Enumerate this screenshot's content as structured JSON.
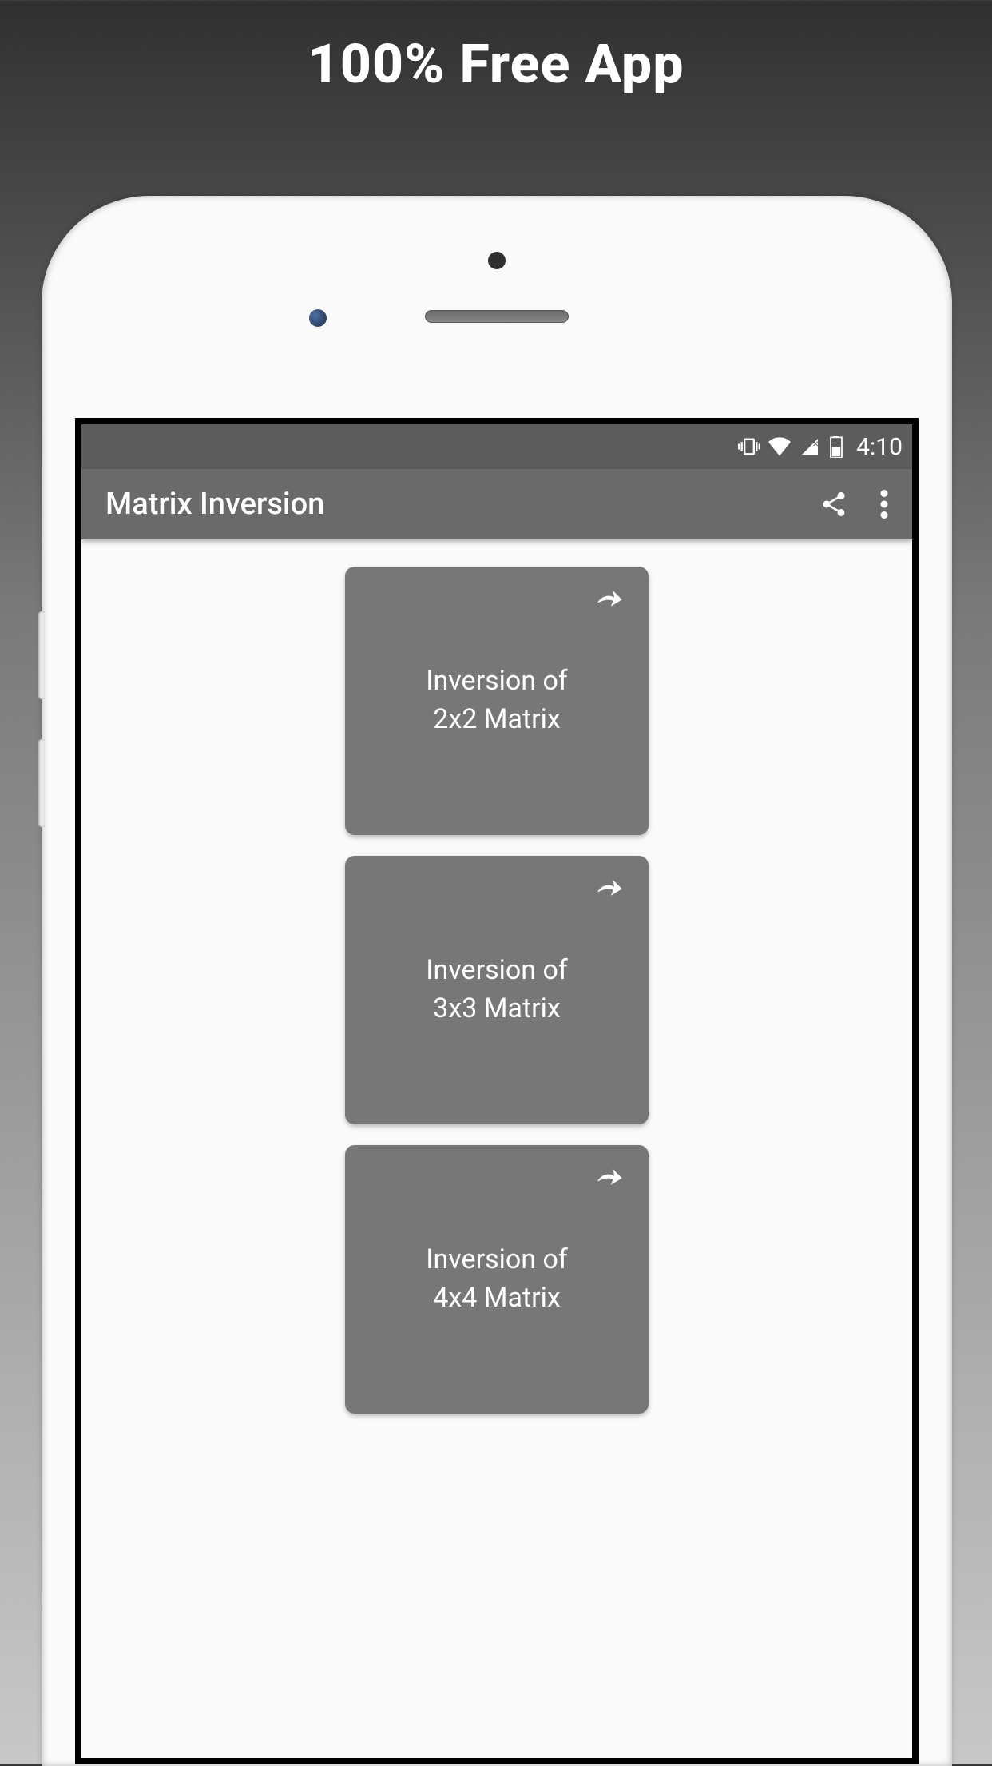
{
  "promo": {
    "title": "100% Free App"
  },
  "statusBar": {
    "time": "4:10"
  },
  "header": {
    "title": "Matrix Inversion"
  },
  "cards": [
    {
      "label": "Inversion of\n2x2 Matrix"
    },
    {
      "label": "Inversion of\n3x3 Matrix"
    },
    {
      "label": "Inversion of\n4x4 Matrix"
    }
  ]
}
